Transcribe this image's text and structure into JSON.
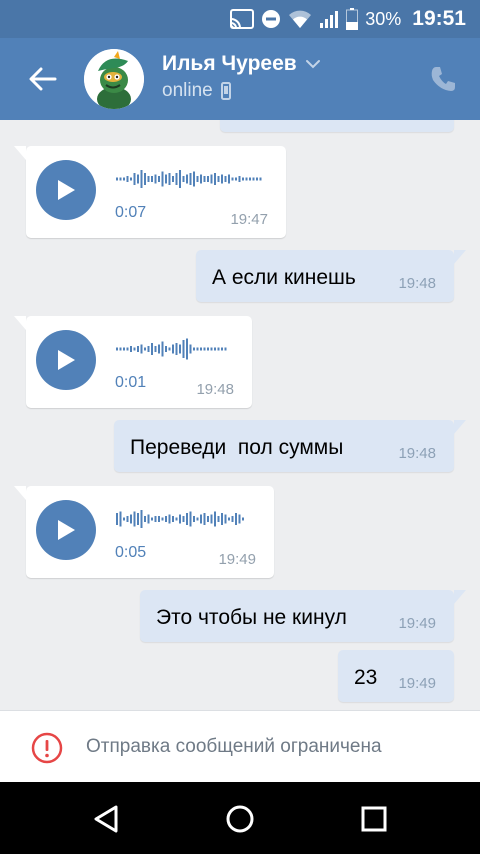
{
  "status_bar": {
    "battery": "30%",
    "time": "19:51"
  },
  "header": {
    "contact_name": "Илья Чуреев",
    "status": "online",
    "icons": [
      "back-arrow-icon",
      "chevron-down-icon",
      "mobile-phone-icon",
      "phone-icon"
    ]
  },
  "messages": [
    {
      "type": "voice",
      "direction": "in",
      "duration": "0:07",
      "time": "19:47"
    },
    {
      "type": "text",
      "direction": "out",
      "text": "А если кинешь",
      "time": "19:48"
    },
    {
      "type": "voice",
      "direction": "in",
      "duration": "0:01",
      "time": "19:48"
    },
    {
      "type": "text",
      "direction": "out",
      "text": "Переведи  пол суммы",
      "time": "19:48"
    },
    {
      "type": "voice",
      "direction": "in",
      "duration": "0:05",
      "time": "19:49"
    },
    {
      "type": "text",
      "direction": "out",
      "text": "Это чтобы не кинул",
      "time": "19:49"
    },
    {
      "type": "text",
      "direction": "out",
      "text": "23",
      "time": "19:49"
    }
  ],
  "notice": {
    "text": "Отправка сообщений ограничена",
    "icon": "alert-circle-icon"
  },
  "colors": {
    "status_bar": "#4a76a8",
    "header": "#5181b8",
    "accent": "#5181b8",
    "outgoing_bubble": "#dce6f4",
    "chat_background": "#edeef0",
    "alert": "#e64646"
  }
}
